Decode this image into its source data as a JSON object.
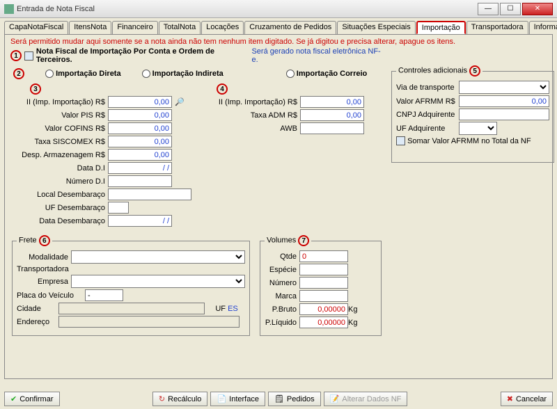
{
  "window": {
    "title": "Entrada de Nota Fiscal"
  },
  "tabs": {
    "t0": "CapaNotaFiscal",
    "t1": "ItensNota",
    "t2": "Financeiro",
    "t3": "TotalNota",
    "t4": "Locações",
    "t5": "Cruzamento de Pedidos",
    "t6": "Situações Especiais",
    "t7": "Importação",
    "t8": "Transportadora",
    "t9": "Informações Adicionais"
  },
  "msgs": {
    "warn": "Será permitido mudar aqui somente se a nota ainda não tem nenhum item digitado. Se já digitou e precisa alterar, apague os itens.",
    "heading": "Nota Fiscal de Importação Por Conta e Ordem de Terceiros.",
    "nfe": "Será gerado nota fiscal eletrônica NF-e."
  },
  "radios": {
    "direta": "Importação Direta",
    "indireta": "Importação Indireta",
    "correio": "Importação Correio"
  },
  "circles": {
    "c1": "1",
    "c2": "2",
    "c3": "3",
    "c4": "4",
    "c5": "5",
    "c6": "6",
    "c7": "7"
  },
  "left": {
    "ii": {
      "label": "II (Imp. Importação) R$",
      "value": "0,00"
    },
    "pis": {
      "label": "Valor PIS R$",
      "value": "0,00"
    },
    "cofins": {
      "label": "Valor COFINS R$",
      "value": "0,00"
    },
    "siscomex": {
      "label": "Taxa SISCOMEX R$",
      "value": "0,00"
    },
    "armaz": {
      "label": "Desp. Armazenagem R$",
      "value": "0,00"
    },
    "datadi": {
      "label": "Data D.I",
      "value": "/ /"
    },
    "numdi": {
      "label": "Número D.I",
      "value": ""
    },
    "localdes": {
      "label": "Local Desembaraço",
      "value": ""
    },
    "ufdes": {
      "label": "UF Desembaraço",
      "value": ""
    },
    "datades": {
      "label": "Data Desembaraço",
      "value": "/ /"
    }
  },
  "mid": {
    "ii": {
      "label": "II (Imp. Importação) R$",
      "value": "0,00"
    },
    "adm": {
      "label": "Taxa ADM R$",
      "value": "0,00"
    },
    "awb": {
      "label": "AWB",
      "value": ""
    }
  },
  "ctrl": {
    "title": "Controles adicionais",
    "via": "Via de transporte",
    "afrmm": {
      "label": "Valor AFRMM R$",
      "value": "0,00"
    },
    "cnpj": "CNPJ Adquirente",
    "ufadq": "UF Adquirente",
    "somar": "Somar Valor AFRMM no Total da NF"
  },
  "frete": {
    "title": "Frete",
    "modalidade": "Modalidade",
    "transportadora": "Transportadora",
    "empresa": "Empresa",
    "placa": "Placa do Veículo",
    "placaval": "-",
    "cidade": "Cidade",
    "uf": "UF",
    "ufval": "ES",
    "endereco": "Endereço"
  },
  "vol": {
    "title": "Volumes",
    "qtde": {
      "label": "Qtde",
      "value": "0"
    },
    "especie": "Espécie",
    "numero": "Número",
    "marca": "Marca",
    "pbruto": {
      "label": "P.Bruto",
      "value": "0,00000",
      "unit": "Kg"
    },
    "pliq": {
      "label": "P.Líquido",
      "value": "0,00000",
      "unit": "Kg"
    }
  },
  "buttons": {
    "confirmar": "Confirmar",
    "recalculo": "Recálculo",
    "interface": "Interface",
    "pedidos": "Pedidos",
    "alterar": "Alterar Dados NF",
    "cancelar": "Cancelar"
  }
}
